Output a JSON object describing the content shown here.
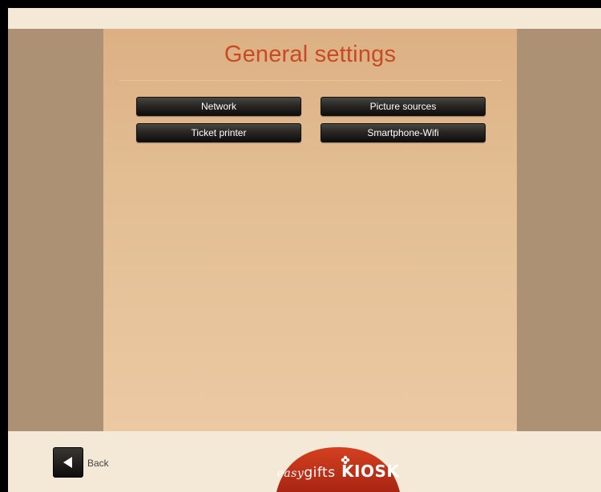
{
  "page": {
    "title": "General settings"
  },
  "buttons": {
    "network": "Network",
    "picture_sources": "Picture sources",
    "ticket_printer": "Ticket printer",
    "smartphone_wifi": "Smartphone-Wifi"
  },
  "footer": {
    "back_label": "Back",
    "logo": {
      "easy": "easy",
      "gifts": "gifts",
      "kiosk": "KIOSK"
    }
  },
  "colors": {
    "title": "#c74a22",
    "side_panel": "#ad9174",
    "center_panel": "#dcb083",
    "background": "#f4e9d6",
    "logo": "#c0311a"
  },
  "icons": {
    "back": "triangle-left-icon",
    "logo_flower": "flower-icon"
  }
}
